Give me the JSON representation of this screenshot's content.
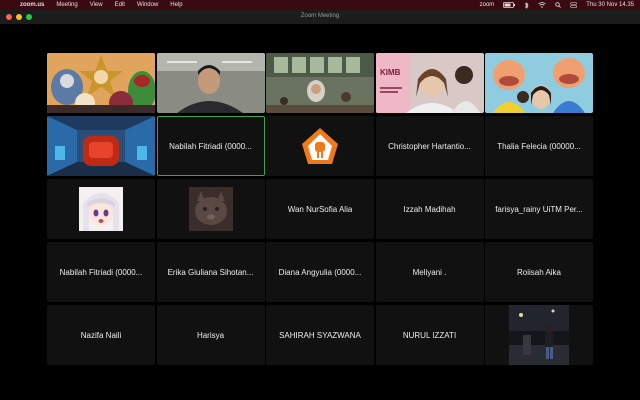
{
  "menubar": {
    "apple_glyph": "",
    "app_name": "zoom.us",
    "menus": [
      "Meeting",
      "View",
      "Edit",
      "Window",
      "Help"
    ],
    "status_app": "zoom",
    "datetime": "Thu 30 Nov  14.35"
  },
  "window": {
    "title": "Zoom Meeting"
  },
  "participants": [
    {
      "name": "",
      "video": "cartoon-villains"
    },
    {
      "name": "",
      "video": "man-classroom"
    },
    {
      "name": "",
      "video": "group-room"
    },
    {
      "name": "",
      "video": "girl-pink-poster"
    },
    {
      "name": "",
      "video": "upin-ipin-cartoon"
    },
    {
      "name": "",
      "video": "3d-armchair-room"
    },
    {
      "name": "Nabilah Fitriadi (0000..."
    },
    {
      "name": "",
      "avatar": "orange-house-logo"
    },
    {
      "name": "Christopher Hartantio..."
    },
    {
      "name": "Thalia Felecia (00000..."
    },
    {
      "name": "",
      "avatar": "anime-girl"
    },
    {
      "name": "",
      "avatar": "cat-photo"
    },
    {
      "name": "Wan NurSofia Alia"
    },
    {
      "name": "Izzah Madihah"
    },
    {
      "name": "farisya_rainy UiTM Per..."
    },
    {
      "name": "Nabilah Fitriadi (0000..."
    },
    {
      "name": "Erika Giuliana Sihotan..."
    },
    {
      "name": "Diana Angyulia (0000..."
    },
    {
      "name": "Meliyani ."
    },
    {
      "name": "Roiisah Aika"
    },
    {
      "name": "Nazifa Naili"
    },
    {
      "name": "Harisya"
    },
    {
      "name": "SAHIRAH SYAZWANA"
    },
    {
      "name": "NURUL IZZATI"
    },
    {
      "name": "",
      "avatar": "night-street-photo"
    }
  ],
  "colors": {
    "menubar_bg": "#3a0a12",
    "speaker_outline": "#3fa34d",
    "close": "#ff5f57",
    "minimize": "#febc2e",
    "zoom": "#28c840"
  }
}
